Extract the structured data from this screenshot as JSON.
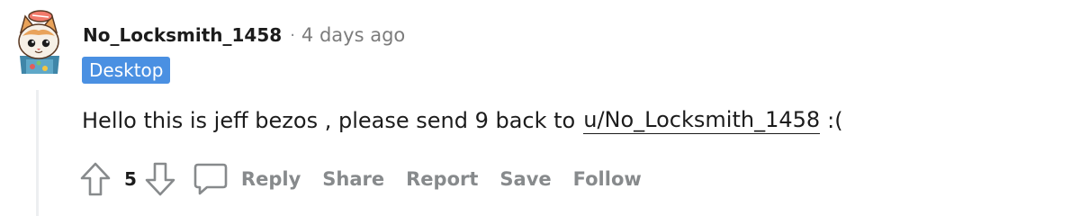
{
  "comment": {
    "author": "No_Locksmith_1458",
    "separator": "·",
    "time_ago": "4 days ago",
    "flair": "Desktop",
    "body_prefix": "Hello this is jeff bezos , please send 9 back to",
    "user_link": "u/No_Locksmith_1458",
    "body_suffix": ":(",
    "score": "5"
  },
  "actions": {
    "reply_label": "Reply",
    "share_label": "Share",
    "report_label": "Report",
    "save_label": "Save",
    "follow_label": "Follow"
  },
  "icons": {
    "avatar": "snoo-cat-avatar",
    "upvote": "arrow-up-outline-icon",
    "downvote": "arrow-down-outline-icon",
    "comment": "speech-bubble-icon"
  },
  "colors": {
    "flair_bg": "#4a90e2",
    "muted_text": "#878a8c",
    "thread_line": "#edeff1"
  }
}
